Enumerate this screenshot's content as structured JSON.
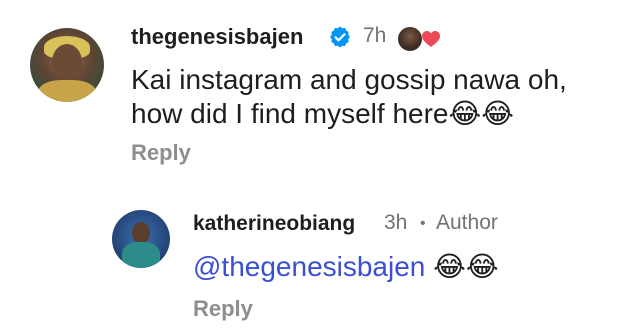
{
  "comment": {
    "username": "thegenesisbajen",
    "time": "7h",
    "text_line1": "Kai instagram and gossip nawa oh,",
    "text_line2": "how did I find myself here",
    "emojis": "😂😂",
    "reply_label": "Reply"
  },
  "reply": {
    "username": "katherineobiang",
    "time": "3h",
    "separator": "•",
    "author_label": "Author",
    "mention": "@thegenesisbajen",
    "emojis": "😂😂",
    "reply_label": "Reply"
  },
  "icons": {
    "verified": "verified-badge-icon",
    "heart": "heart-icon"
  },
  "colors": {
    "verified_blue": "#0095f6",
    "heart_red": "#ed4956",
    "mention_blue": "#3a4fd6",
    "muted_gray": "#737373"
  }
}
